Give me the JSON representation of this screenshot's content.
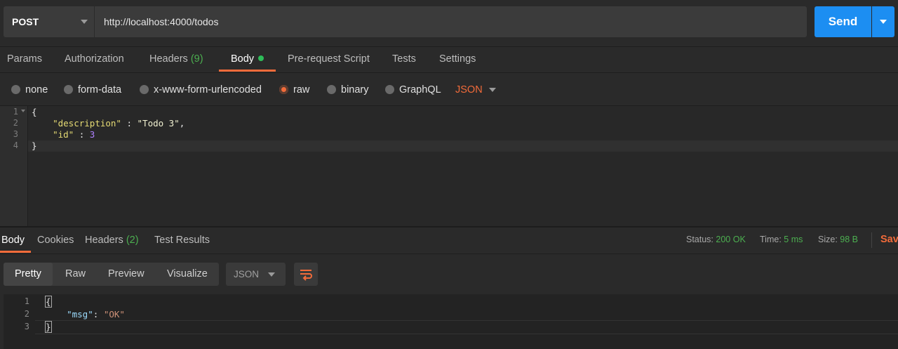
{
  "request": {
    "method": "POST",
    "url": "http://localhost:4000/todos",
    "send_label": "Send"
  },
  "tabs": {
    "params": "Params",
    "authorization": "Authorization",
    "headers": "Headers",
    "headers_count": "(9)",
    "body": "Body",
    "prerequest": "Pre-request Script",
    "tests": "Tests",
    "settings": "Settings"
  },
  "body_types": {
    "none": "none",
    "form_data": "form-data",
    "urlencoded": "x-www-form-urlencoded",
    "raw": "raw",
    "binary": "binary",
    "graphql": "GraphQL",
    "selected": "raw",
    "format": "JSON"
  },
  "editor": {
    "line_numbers": [
      "1",
      "2",
      "3",
      "4"
    ],
    "open": "{",
    "key1": "\"description\"",
    "sep1": " : ",
    "val1": "\"Todo 3\"",
    "comma": ",",
    "key2": "\"id\"",
    "sep2": " : ",
    "val2": "3",
    "close": "}"
  },
  "response_tabs": {
    "body": "Body",
    "cookies": "Cookies",
    "headers": "Headers",
    "headers_count": "(2)",
    "test_results": "Test Results"
  },
  "status": {
    "status_label": "Status:",
    "status_value": "200 OK",
    "time_label": "Time:",
    "time_value": "5 ms",
    "size_label": "Size:",
    "size_value": "98 B",
    "save": "Save"
  },
  "view_modes": {
    "pretty": "Pretty",
    "raw": "Raw",
    "preview": "Preview",
    "visualize": "Visualize",
    "format": "JSON"
  },
  "response": {
    "line_numbers": [
      "1",
      "2",
      "3"
    ],
    "open": "{",
    "key": "\"msg\"",
    "sep": ": ",
    "value": "\"OK\"",
    "close": "}"
  },
  "colors": {
    "accent": "#f26b3a",
    "send": "#1c8ef2",
    "success": "#4caf50"
  }
}
